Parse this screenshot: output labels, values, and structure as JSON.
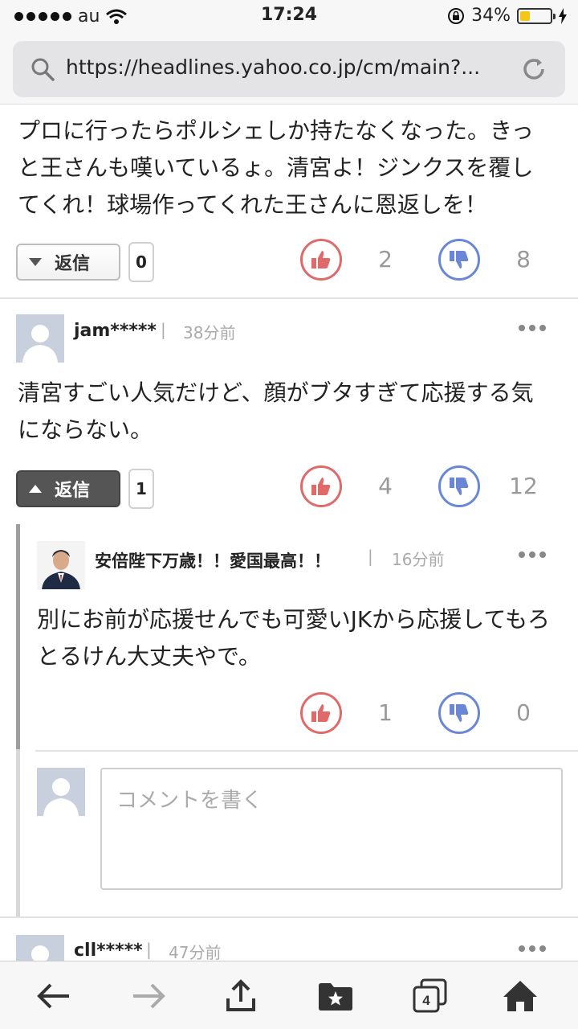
{
  "status_bar": {
    "carrier": "au",
    "time": "17:24",
    "battery": "34%",
    "battery_level": 0.34
  },
  "browser": {
    "url": "https://headlines.yahoo.co.jp/cm/main?...",
    "tab_count": "4"
  },
  "comments": [
    {
      "text": "プロに行ったらポルシェしか持たなくなった。きっと王さんも嘆いているょ。清宮よ！ジンクスを覆してくれ！球場作ってくれた王さんに恩返しを！",
      "reply_label": "返信",
      "reply_count": "0",
      "likes": "2",
      "dislikes": "8"
    },
    {
      "user": "jam*****",
      "time": "38分前",
      "text": "清宮すごい人気だけど、顔がブタすぎて応援する気にならない。",
      "reply_label": "返信",
      "reply_count": "1",
      "likes": "4",
      "dislikes": "12",
      "replies": [
        {
          "user": "安倍陛下万歳！！愛国最高！！",
          "time": "16分前",
          "text": "別にお前が応援せんでも可愛いJKから応援してもろとるけん大丈夫やで。",
          "likes": "1",
          "dislikes": "0"
        }
      ]
    },
    {
      "user": "cll*****",
      "time": "47分前"
    }
  ],
  "compose": {
    "placeholder": "コメントを書く"
  },
  "colors": {
    "like": "#e06a6a",
    "dislike": "#6a86d6",
    "battery": "#f5c518"
  }
}
